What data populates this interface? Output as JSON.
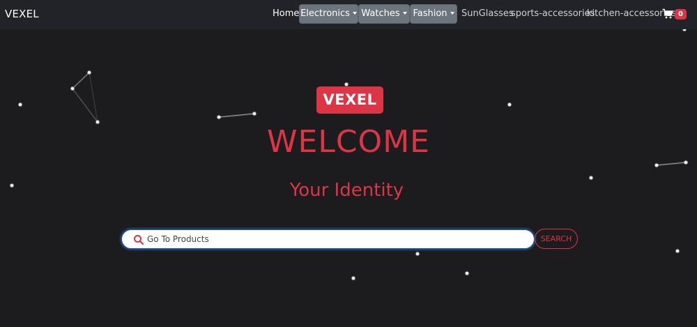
{
  "navbar": {
    "brand": "VEXEL",
    "links": {
      "home": "Home",
      "electronics": "Electronics",
      "watches": "Watches",
      "fashion": "Fashion",
      "sunglasses": "SunGlasses",
      "sports": "sports-accessories",
      "kitchen": "kitchen-accessories"
    },
    "cart_count": "0"
  },
  "hero": {
    "logo": "VEXEL",
    "title": "WELCOME",
    "subtitle": "Your Identity"
  },
  "search": {
    "placeholder": "Go To Products",
    "button_label": "SEARCH"
  },
  "colors": {
    "accent": "#dc3545",
    "background": "#1c1c1e",
    "navbar": "#222328",
    "dropdown": "#6c757d"
  },
  "icons": [
    "cart-icon",
    "search-icon"
  ]
}
